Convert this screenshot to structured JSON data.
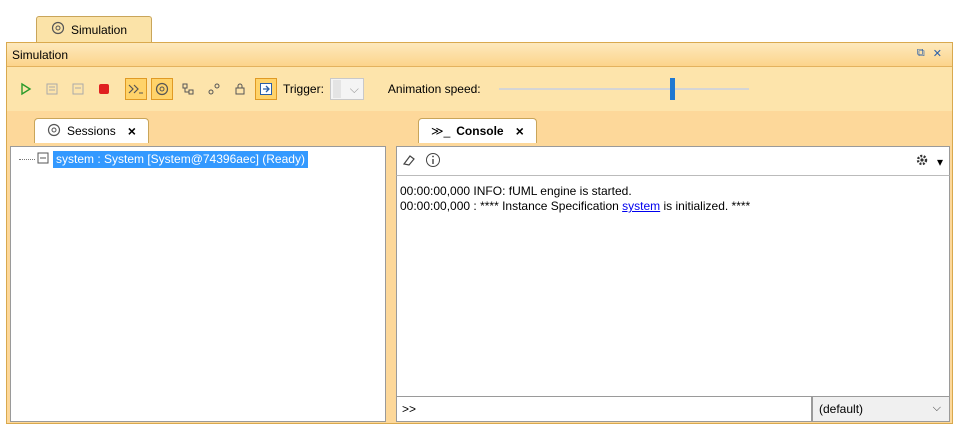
{
  "outer_tab": {
    "label": "Simulation"
  },
  "window": {
    "title": "Simulation"
  },
  "toolbar": {
    "trigger_label": "Trigger:",
    "speed_label": "Animation speed:",
    "speed_value": 0.7
  },
  "sessions": {
    "tab_label": "Sessions",
    "close": "×",
    "items": [
      {
        "label": "system : System [System@74396aec] (Ready)"
      }
    ]
  },
  "console": {
    "tab_label": "Console",
    "tab_prefix": "≫_",
    "close": "×",
    "lines": [
      {
        "text": "00:00:00,000 INFO: fUML engine is started."
      },
      {
        "prefix": "00:00:00,000 : **** Instance Specification ",
        "link": "system",
        "suffix": " is initialized. ****"
      }
    ],
    "input_value": ">>",
    "select_value": "(default)"
  },
  "colors": {
    "accent": "#fdd89a",
    "selection": "#3399ff",
    "slider": "#1f78d1",
    "stop": "#e02020"
  }
}
